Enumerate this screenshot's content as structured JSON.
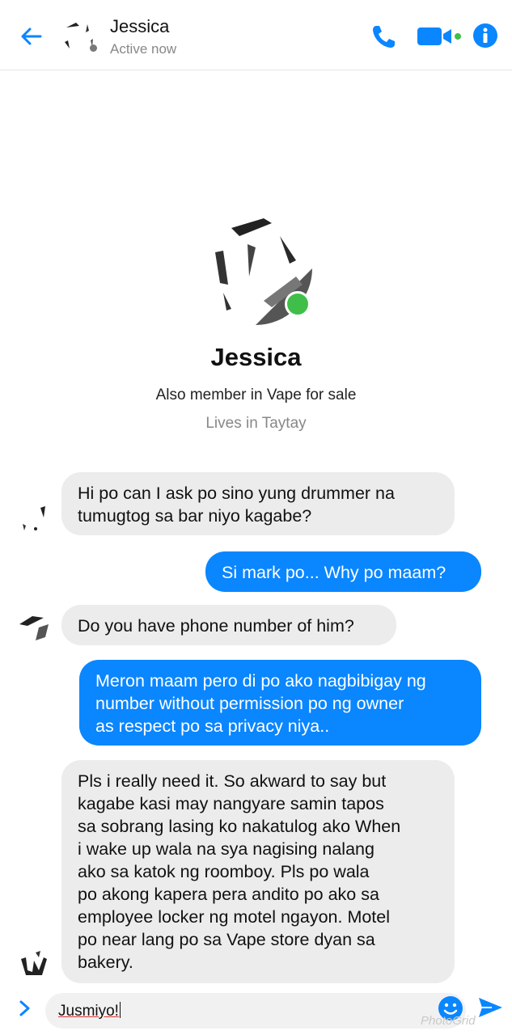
{
  "header": {
    "contact_name": "Jessica",
    "status": "Active now",
    "icons": [
      "back-arrow-icon",
      "phone-icon",
      "video-icon",
      "info-icon"
    ],
    "accent_color": "#0a86ff"
  },
  "profile": {
    "name": "Jessica",
    "group_line": "Also member in Vape for sale",
    "location_line": "Lives in Taytay",
    "online_color": "#3fbf4a"
  },
  "messages": [
    {
      "direction": "in",
      "lines": [
        "Hi po can I ask po sino yung drummer na",
        "tumugtog sa bar niyo kagabe?"
      ]
    },
    {
      "direction": "out",
      "lines": [
        "Si mark po... Why po maam?"
      ]
    },
    {
      "direction": "in",
      "lines": [
        "Do you have phone number of him?"
      ]
    },
    {
      "direction": "out",
      "lines": [
        "Meron maam pero di po ako nagbibigay ng",
        "number without permission po ng owner",
        "as respect po sa privacy niya.."
      ]
    },
    {
      "direction": "in",
      "lines": [
        "Pls i really need it. So akward to say but",
        "kagabe kasi may nangyare samin tapos",
        "sa sobrang lasing ko nakatulog ako When",
        "i wake up wala na sya nagising nalang",
        "ako sa katok ng roomboy. Pls po wala",
        "po akong kapera pera andito po ako sa",
        "employee locker ng motel ngayon. Motel",
        "po near lang po sa Vape store dyan sa",
        "bakery."
      ]
    }
  ],
  "composer": {
    "input_value": "Jusmiyo!",
    "icons": [
      "chevron-right-icon",
      "emoji-icon",
      "send-icon"
    ]
  },
  "watermark": "PhotoGrid"
}
